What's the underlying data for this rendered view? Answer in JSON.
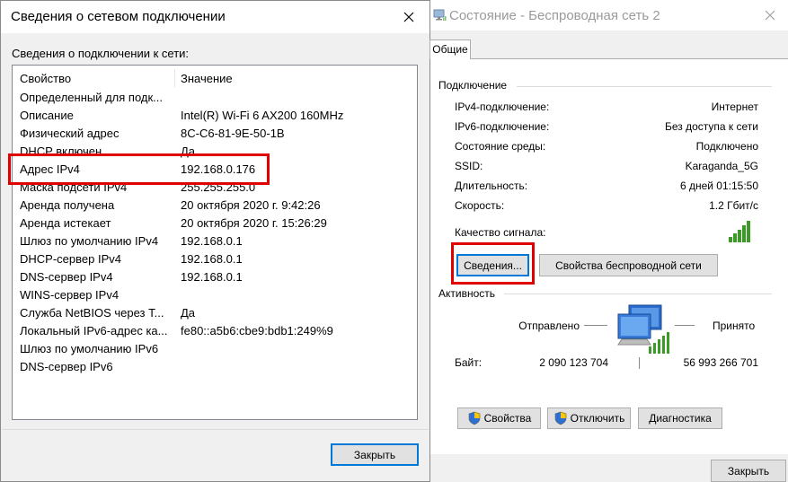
{
  "status_window": {
    "title": "Состояние - Беспроводная сеть 2",
    "tab": "Общие",
    "connection_header": "Подключение",
    "rows": [
      {
        "label": "IPv4-подключение:",
        "value": "Интернет"
      },
      {
        "label": "IPv6-подключение:",
        "value": "Без доступа к сети"
      },
      {
        "label": "Состояние среды:",
        "value": "Подключено"
      },
      {
        "label": "SSID:",
        "value": "Karaganda_5G"
      },
      {
        "label": "Длительность:",
        "value": "6 дней 01:15:50"
      },
      {
        "label": "Скорость:",
        "value": "1.2 Гбит/с"
      }
    ],
    "signal_label": "Качество сигнала:",
    "details_button": "Сведения...",
    "wireless_props_button": "Свойства беспроводной сети",
    "activity_header": "Активность",
    "sent_label": "Отправлено",
    "received_label": "Принято",
    "bytes_label": "Байт:",
    "bytes_sent": "2 090 123 704",
    "bytes_received": "56 993 266 701",
    "properties_button": "Свойства",
    "disable_button": "Отключить",
    "diagnose_button": "Диагностика",
    "close_button": "Закрыть"
  },
  "details_window": {
    "title": "Сведения о сетевом подключении",
    "subtitle": "Сведения о подключении к сети:",
    "columns": {
      "property": "Свойство",
      "value": "Значение"
    },
    "rows": [
      {
        "property": "Определенный для подк...",
        "value": ""
      },
      {
        "property": "Описание",
        "value": "Intel(R) Wi-Fi 6 AX200 160MHz"
      },
      {
        "property": "Физический адрес",
        "value": "8C-C6-81-9E-50-1B"
      },
      {
        "property": "DHCP включен",
        "value": "Да"
      },
      {
        "property": "Адрес IPv4",
        "value": "192.168.0.176"
      },
      {
        "property": "Маска подсети IPv4",
        "value": "255.255.255.0"
      },
      {
        "property": "Аренда получена",
        "value": "20 октября 2020 г. 9:42:26"
      },
      {
        "property": "Аренда истекает",
        "value": "20 октября 2020 г. 15:26:29"
      },
      {
        "property": "Шлюз по умолчанию IPv4",
        "value": "192.168.0.1"
      },
      {
        "property": "DHCP-сервер IPv4",
        "value": "192.168.0.1"
      },
      {
        "property": "DNS-сервер IPv4",
        "value": "192.168.0.1"
      },
      {
        "property": "WINS-сервер IPv4",
        "value": ""
      },
      {
        "property": "Служба NetBIOS через Т...",
        "value": "Да"
      },
      {
        "property": "Локальный IPv6-адрес ка...",
        "value": "fe80::a5b6:cbe9:bdb1:249%9"
      },
      {
        "property": "Шлюз по умолчанию IPv6",
        "value": ""
      },
      {
        "property": "DNS-сервер IPv6",
        "value": ""
      }
    ],
    "close_button": "Закрыть"
  },
  "icons": {
    "close": "close-icon",
    "network": "network-icon",
    "signal": "signal-bars-icon",
    "computers": "network-computers-icon",
    "shield": "uac-shield-icon"
  },
  "colors": {
    "highlight_red": "#e00000",
    "signal_green": "#3b9a28",
    "focus_blue": "#0078d7"
  }
}
